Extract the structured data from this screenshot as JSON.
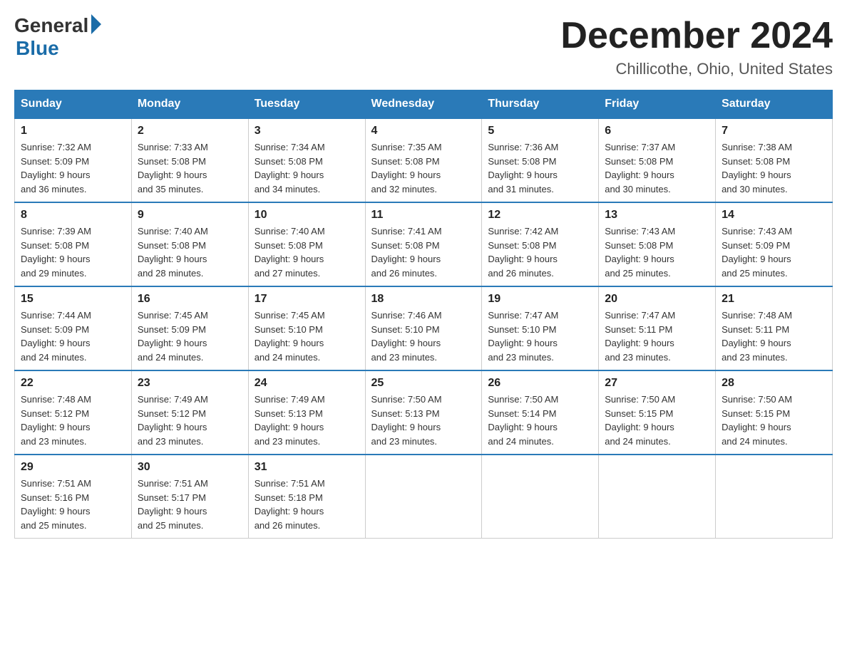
{
  "logo": {
    "general": "General",
    "blue": "Blue"
  },
  "title": "December 2024",
  "location": "Chillicothe, Ohio, United States",
  "headers": [
    "Sunday",
    "Monday",
    "Tuesday",
    "Wednesday",
    "Thursday",
    "Friday",
    "Saturday"
  ],
  "weeks": [
    [
      {
        "day": "1",
        "sunrise": "7:32 AM",
        "sunset": "5:09 PM",
        "daylight": "9 hours and 36 minutes."
      },
      {
        "day": "2",
        "sunrise": "7:33 AM",
        "sunset": "5:08 PM",
        "daylight": "9 hours and 35 minutes."
      },
      {
        "day": "3",
        "sunrise": "7:34 AM",
        "sunset": "5:08 PM",
        "daylight": "9 hours and 34 minutes."
      },
      {
        "day": "4",
        "sunrise": "7:35 AM",
        "sunset": "5:08 PM",
        "daylight": "9 hours and 32 minutes."
      },
      {
        "day": "5",
        "sunrise": "7:36 AM",
        "sunset": "5:08 PM",
        "daylight": "9 hours and 31 minutes."
      },
      {
        "day": "6",
        "sunrise": "7:37 AM",
        "sunset": "5:08 PM",
        "daylight": "9 hours and 30 minutes."
      },
      {
        "day": "7",
        "sunrise": "7:38 AM",
        "sunset": "5:08 PM",
        "daylight": "9 hours and 30 minutes."
      }
    ],
    [
      {
        "day": "8",
        "sunrise": "7:39 AM",
        "sunset": "5:08 PM",
        "daylight": "9 hours and 29 minutes."
      },
      {
        "day": "9",
        "sunrise": "7:40 AM",
        "sunset": "5:08 PM",
        "daylight": "9 hours and 28 minutes."
      },
      {
        "day": "10",
        "sunrise": "7:40 AM",
        "sunset": "5:08 PM",
        "daylight": "9 hours and 27 minutes."
      },
      {
        "day": "11",
        "sunrise": "7:41 AM",
        "sunset": "5:08 PM",
        "daylight": "9 hours and 26 minutes."
      },
      {
        "day": "12",
        "sunrise": "7:42 AM",
        "sunset": "5:08 PM",
        "daylight": "9 hours and 26 minutes."
      },
      {
        "day": "13",
        "sunrise": "7:43 AM",
        "sunset": "5:08 PM",
        "daylight": "9 hours and 25 minutes."
      },
      {
        "day": "14",
        "sunrise": "7:43 AM",
        "sunset": "5:09 PM",
        "daylight": "9 hours and 25 minutes."
      }
    ],
    [
      {
        "day": "15",
        "sunrise": "7:44 AM",
        "sunset": "5:09 PM",
        "daylight": "9 hours and 24 minutes."
      },
      {
        "day": "16",
        "sunrise": "7:45 AM",
        "sunset": "5:09 PM",
        "daylight": "9 hours and 24 minutes."
      },
      {
        "day": "17",
        "sunrise": "7:45 AM",
        "sunset": "5:10 PM",
        "daylight": "9 hours and 24 minutes."
      },
      {
        "day": "18",
        "sunrise": "7:46 AM",
        "sunset": "5:10 PM",
        "daylight": "9 hours and 23 minutes."
      },
      {
        "day": "19",
        "sunrise": "7:47 AM",
        "sunset": "5:10 PM",
        "daylight": "9 hours and 23 minutes."
      },
      {
        "day": "20",
        "sunrise": "7:47 AM",
        "sunset": "5:11 PM",
        "daylight": "9 hours and 23 minutes."
      },
      {
        "day": "21",
        "sunrise": "7:48 AM",
        "sunset": "5:11 PM",
        "daylight": "9 hours and 23 minutes."
      }
    ],
    [
      {
        "day": "22",
        "sunrise": "7:48 AM",
        "sunset": "5:12 PM",
        "daylight": "9 hours and 23 minutes."
      },
      {
        "day": "23",
        "sunrise": "7:49 AM",
        "sunset": "5:12 PM",
        "daylight": "9 hours and 23 minutes."
      },
      {
        "day": "24",
        "sunrise": "7:49 AM",
        "sunset": "5:13 PM",
        "daylight": "9 hours and 23 minutes."
      },
      {
        "day": "25",
        "sunrise": "7:50 AM",
        "sunset": "5:13 PM",
        "daylight": "9 hours and 23 minutes."
      },
      {
        "day": "26",
        "sunrise": "7:50 AM",
        "sunset": "5:14 PM",
        "daylight": "9 hours and 24 minutes."
      },
      {
        "day": "27",
        "sunrise": "7:50 AM",
        "sunset": "5:15 PM",
        "daylight": "9 hours and 24 minutes."
      },
      {
        "day": "28",
        "sunrise": "7:50 AM",
        "sunset": "5:15 PM",
        "daylight": "9 hours and 24 minutes."
      }
    ],
    [
      {
        "day": "29",
        "sunrise": "7:51 AM",
        "sunset": "5:16 PM",
        "daylight": "9 hours and 25 minutes."
      },
      {
        "day": "30",
        "sunrise": "7:51 AM",
        "sunset": "5:17 PM",
        "daylight": "9 hours and 25 minutes."
      },
      {
        "day": "31",
        "sunrise": "7:51 AM",
        "sunset": "5:18 PM",
        "daylight": "9 hours and 26 minutes."
      },
      null,
      null,
      null,
      null
    ]
  ],
  "labels": {
    "sunrise": "Sunrise:",
    "sunset": "Sunset:",
    "daylight": "Daylight:"
  }
}
